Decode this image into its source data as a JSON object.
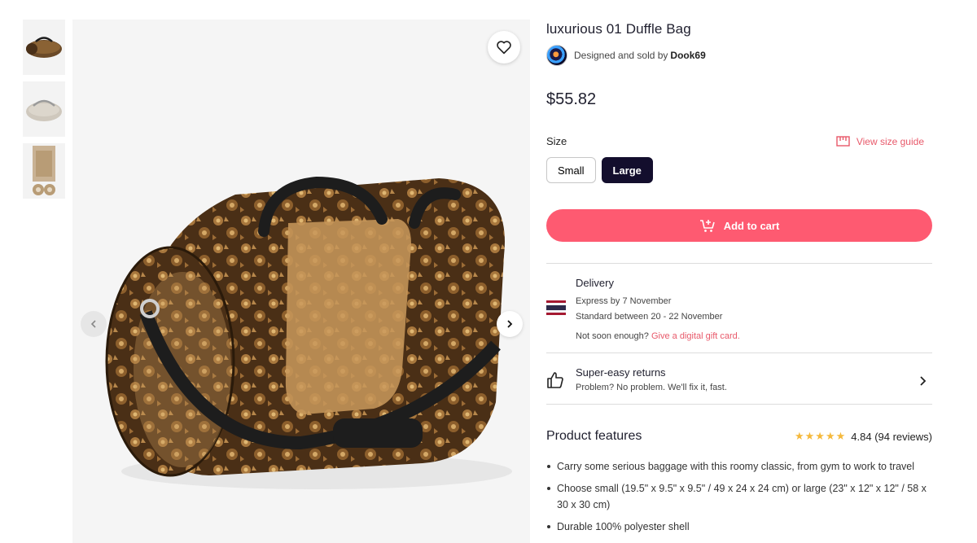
{
  "product": {
    "title": "luxurious 01 Duffle Bag",
    "seller_prefix": "Designed and sold by",
    "seller_name": "Dook69",
    "price": "$55.82"
  },
  "size": {
    "label": "Size",
    "guide_label": "View size guide",
    "options": [
      "Small",
      "Large"
    ],
    "selected": "Large"
  },
  "cart": {
    "label": "Add to cart"
  },
  "delivery": {
    "title": "Delivery",
    "express": "Express by 7 November",
    "standard": "Standard between 20 - 22 November",
    "note_prefix": "Not soon enough?",
    "note_link": "Give a digital gift card."
  },
  "returns": {
    "title": "Super-easy returns",
    "subtitle": "Problem? No problem. We'll fix it, fast."
  },
  "features": {
    "title": "Product features",
    "rating_value": "4.84",
    "rating_count": "(94 reviews)",
    "stars": 5,
    "items": [
      "Carry some serious baggage with this roomy classic, from gym to work to travel",
      "Choose small (19.5\" x 9.5\" x 9.5\" / 49 x 24 x 24 cm) or large (23\" x 12\" x 12\" / 58 x 30 x 30 cm)",
      "Durable 100% polyester shell"
    ]
  },
  "colors": {
    "accent": "#fe5a71",
    "link": "#e8596a",
    "selected_size": "#130e2d",
    "star": "#f5b93c"
  },
  "icons": [
    "heart-icon",
    "chevron-left-icon",
    "chevron-right-icon",
    "ruler-icon",
    "cart-plus-icon",
    "thailand-flag-icon",
    "thumbs-up-icon"
  ]
}
